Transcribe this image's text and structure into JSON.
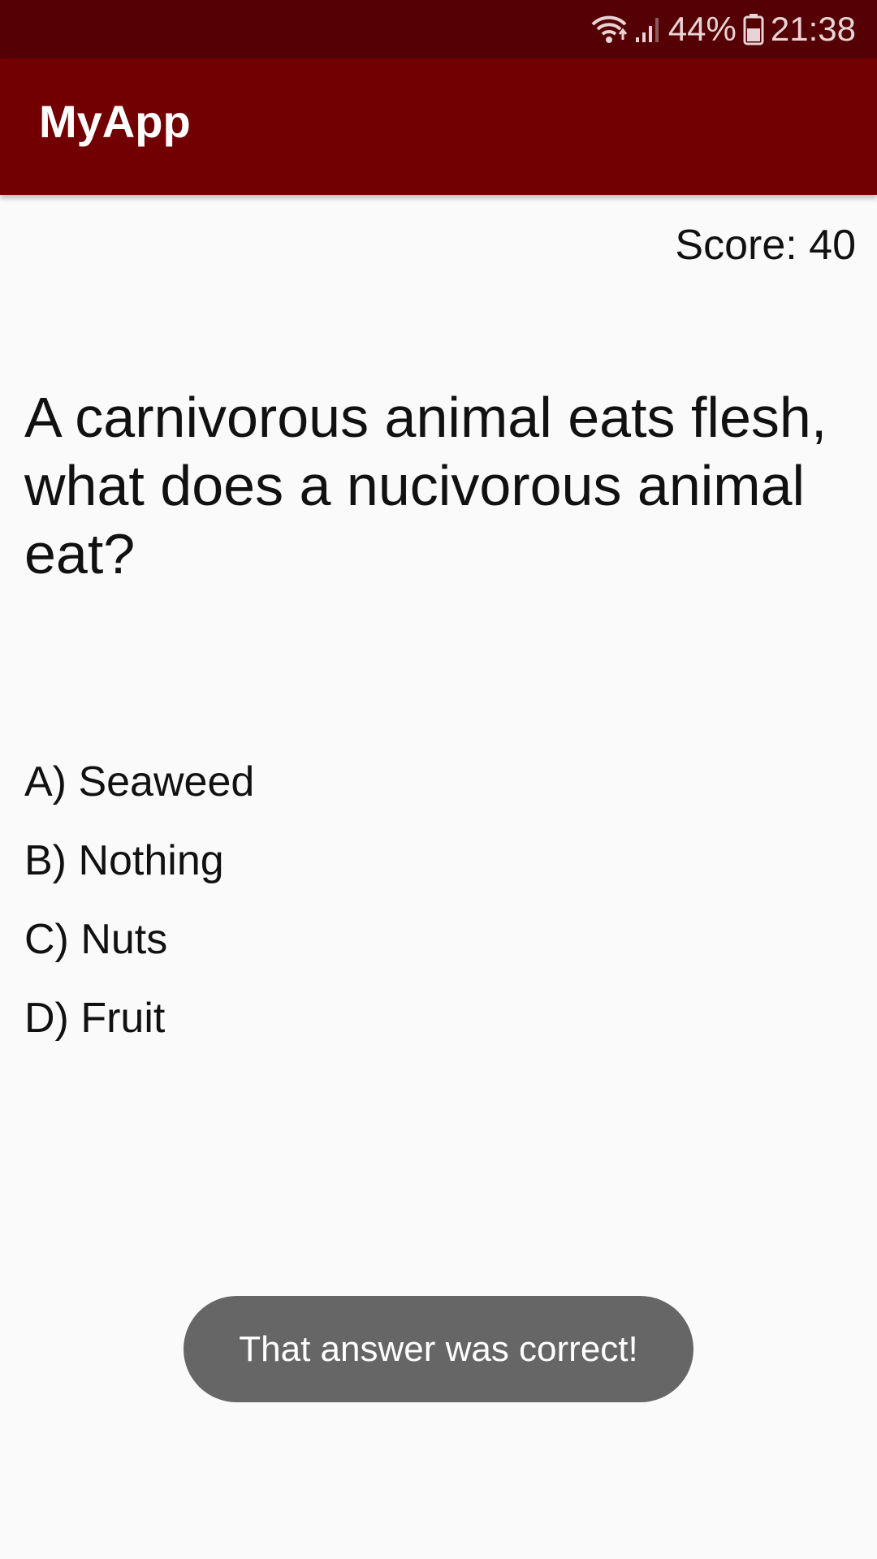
{
  "status_bar": {
    "battery_percent": "44%",
    "time": "21:38",
    "icons": [
      "wifi-icon",
      "signal-icon",
      "battery-icon"
    ]
  },
  "app_bar": {
    "title": "MyApp",
    "color": "#720003"
  },
  "quiz": {
    "score_label": "Score: 40",
    "question": "A carnivorous animal eats flesh, what does a nucivorous animal eat?",
    "answers": [
      {
        "label": "A) Seaweed"
      },
      {
        "label": "B) Nothing"
      },
      {
        "label": "C) Nuts"
      },
      {
        "label": "D) Fruit"
      }
    ]
  },
  "toast": {
    "message": "That answer was correct!"
  }
}
